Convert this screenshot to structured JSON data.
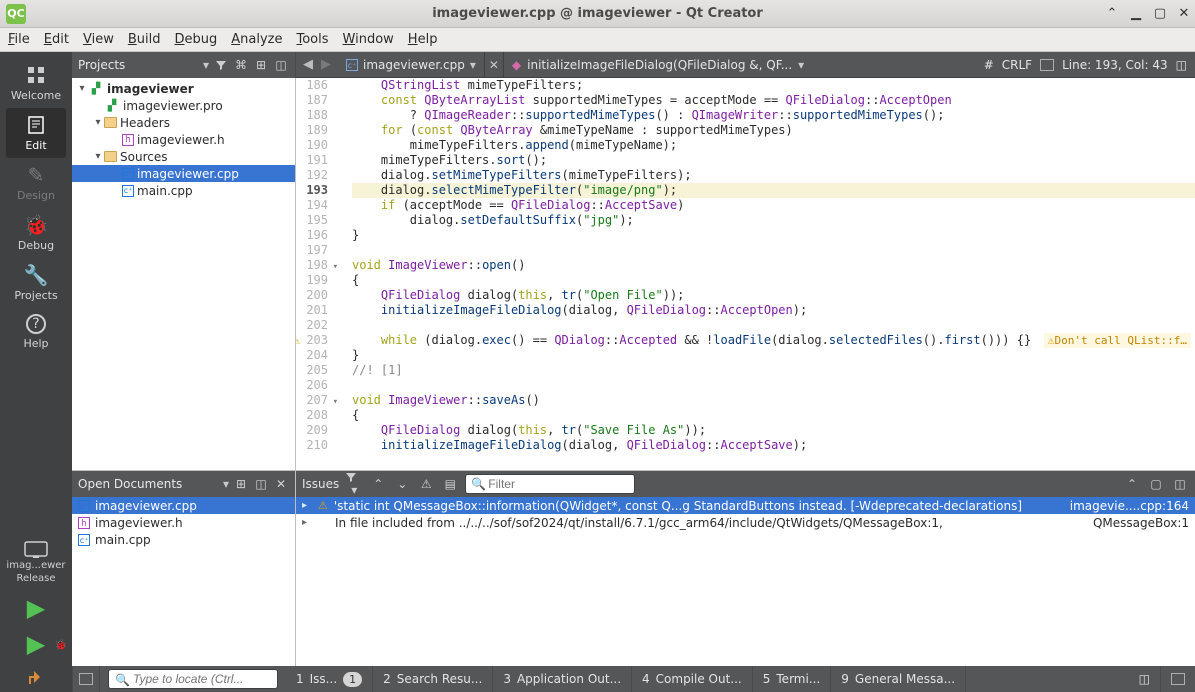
{
  "window": {
    "title": "imageviewer.cpp @ imageviewer - Qt Creator",
    "app_icon_text": "QC"
  },
  "menubar": [
    "File",
    "Edit",
    "View",
    "Build",
    "Debug",
    "Analyze",
    "Tools",
    "Window",
    "Help"
  ],
  "modes": [
    {
      "id": "welcome",
      "label": "Welcome"
    },
    {
      "id": "edit",
      "label": "Edit"
    },
    {
      "id": "design",
      "label": "Design"
    },
    {
      "id": "debug",
      "label": "Debug"
    },
    {
      "id": "projects",
      "label": "Projects"
    },
    {
      "id": "help",
      "label": "Help"
    }
  ],
  "active_mode": "edit",
  "kit": {
    "project": "imag...ewer",
    "config": "Release"
  },
  "projects_header": {
    "label": "Projects"
  },
  "project_tree": [
    {
      "d": 1,
      "exp": true,
      "icon": "pro",
      "label": "imageviewer",
      "bold": true
    },
    {
      "d": 2,
      "exp": null,
      "icon": "pro",
      "label": "imageviewer.pro"
    },
    {
      "d": 2,
      "exp": true,
      "icon": "folder",
      "label": "Headers"
    },
    {
      "d": 3,
      "exp": null,
      "icon": "h",
      "label": "imageviewer.h"
    },
    {
      "d": 2,
      "exp": true,
      "icon": "folder",
      "label": "Sources"
    },
    {
      "d": 3,
      "exp": null,
      "icon": "cpp",
      "label": "imageviewer.cpp",
      "selected": true
    },
    {
      "d": 3,
      "exp": null,
      "icon": "cpp",
      "label": "main.cpp"
    }
  ],
  "editor": {
    "tab": "imageviewer.cpp",
    "symbol": "initializeImageFileDialog(QFileDialog &, QF...",
    "line_status": "Line: 193, Col: 43",
    "first_line": 186,
    "current_line": 193,
    "encoding": "#",
    "eol": "CRLF",
    "fold_lines": [
      198,
      207
    ],
    "warn_lines": [
      203
    ],
    "code": [
      "    QStringList mimeTypeFilters;",
      "    const QByteArrayList supportedMimeTypes = acceptMode == QFileDialog::AcceptOpen",
      "        ? QImageReader::supportedMimeTypes() : QImageWriter::supportedMimeTypes();",
      "    for (const QByteArray &mimeTypeName : supportedMimeTypes)",
      "        mimeTypeFilters.append(mimeTypeName);",
      "    mimeTypeFilters.sort();",
      "    dialog.setMimeTypeFilters(mimeTypeFilters);",
      "    dialog.selectMimeTypeFilter(\"image/png\");",
      "    if (acceptMode == QFileDialog::AcceptSave)",
      "        dialog.setDefaultSuffix(\"jpg\");",
      "}",
      "",
      "void ImageViewer::open()",
      "{",
      "    QFileDialog dialog(this, tr(\"Open File\"));",
      "    initializeImageFileDialog(dialog, QFileDialog::AcceptOpen);",
      "",
      "    while (dialog.exec() == QDialog::Accepted && !loadFile(dialog.selectedFiles().first())) {}",
      "}",
      "//! [1]",
      "",
      "void ImageViewer::saveAs()",
      "{",
      "    QFileDialog dialog(this, tr(\"Save File As\"));",
      "    initializeImageFileDialog(dialog, QFileDialog::AcceptSave);"
    ],
    "inline_warning": "Don't call QList::f…"
  },
  "open_documents": {
    "title": "Open Documents",
    "items": [
      {
        "icon": "cpp",
        "label": "imageviewer.cpp",
        "selected": true
      },
      {
        "icon": "h",
        "label": "imageviewer.h"
      },
      {
        "icon": "cpp",
        "label": "main.cpp"
      }
    ]
  },
  "issues": {
    "title": "Issues",
    "filter_placeholder": "Filter",
    "items": [
      {
        "sev": "warn",
        "expandable": true,
        "msg": "'static int QMessageBox::information(QWidget*, const Q...g StandardButtons instead. [-Wdeprecated-declarations]",
        "loc": "imagevie....cpp:164",
        "selected": true
      },
      {
        "sev": "none",
        "expandable": true,
        "msg": "In file included from ../../../sof/sof2024/qt/install/6.7.1/gcc_arm64/include/QtWidgets/QMessageBox:1,",
        "loc": "QMessageBox:1"
      }
    ]
  },
  "statusbar": {
    "locator_placeholder": "Type to locate (Ctrl...",
    "panes": [
      {
        "num": "1",
        "label": "Iss...",
        "badge": "1"
      },
      {
        "num": "2",
        "label": "Search Resu..."
      },
      {
        "num": "3",
        "label": "Application Out..."
      },
      {
        "num": "4",
        "label": "Compile Out..."
      },
      {
        "num": "5",
        "label": "Termi..."
      },
      {
        "num": "9",
        "label": "General Messa..."
      }
    ]
  }
}
